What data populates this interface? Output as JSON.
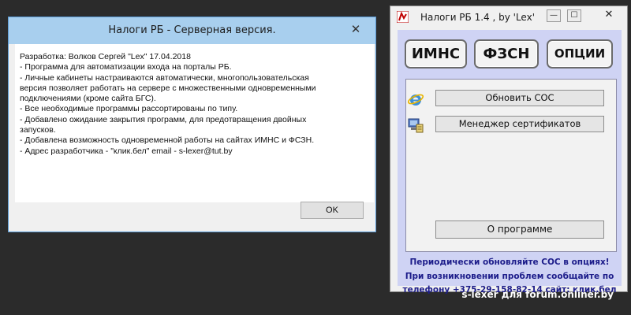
{
  "dialog": {
    "title": "Налоги РБ - Серверная версия.",
    "close_glyph": "✕",
    "lines": [
      "Разработка: Волков Сергей \"Lex\" 17.04.2018",
      "- Программа для автоматизации входа на порталы РБ.",
      "- Личные кабинеты настраиваются автоматически, многопользовательская",
      "версия позволяет работать на сервере с множественными одновременными",
      "подключениями (кроме сайта БГС).",
      "- Все необходимые программы рассортированы по типу.",
      "- Добавлено ожидание закрытия программ, для предотвращения двойных",
      "запусков.",
      "- Добавлена возможность одновременной работы на сайтах ИМНС и ФСЗН.",
      "- Адрес разработчика - \"клик.бел\" email - s-lexer@tut.by"
    ],
    "ok_label": "OK"
  },
  "app": {
    "title": "Налоги РБ 1.4 , by 'Lex'",
    "minimize_glyph": "—",
    "maximize_glyph": "☐",
    "close_glyph": "✕",
    "buttons": {
      "imns": "ИМНС",
      "fszn": "ФЗСН",
      "options": "ОПЦИИ"
    },
    "update_sos": "Обновить СОС",
    "cert_manager": "Менеджер сертификатов",
    "about": "О программе",
    "info_lines": [
      "Периодически обновляйте СОС в опциях!",
      "При возникновении проблем сообщайте по",
      "телефону +375-29-158-82-14 сайт: клик.бел"
    ]
  },
  "watermark": "s-lexer для forum.onliner.by"
}
